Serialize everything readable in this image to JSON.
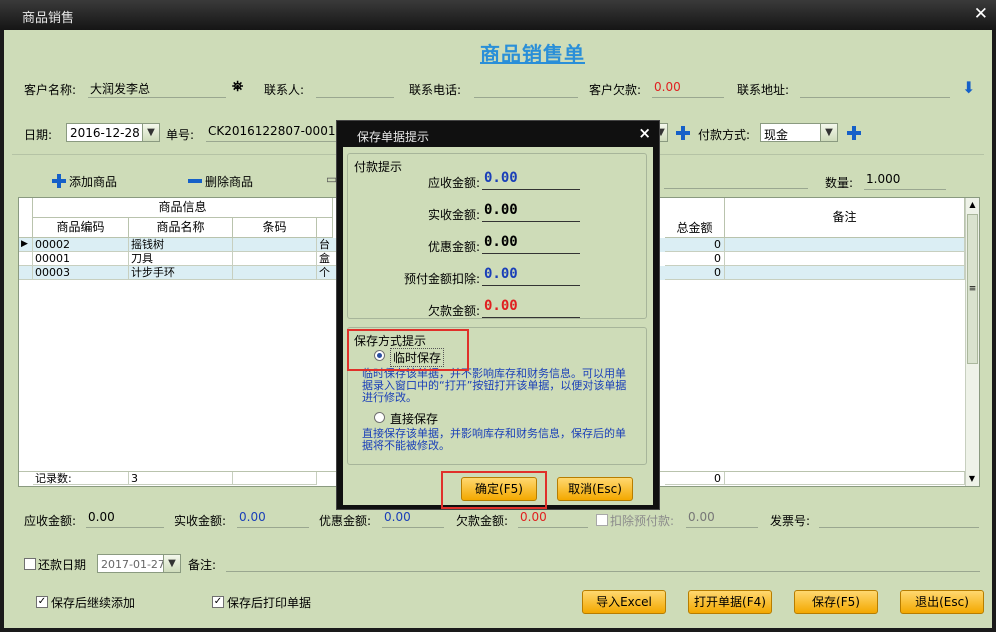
{
  "window": {
    "title": "商品销售",
    "close": "✕"
  },
  "page_title": "商品销售单",
  "customer_row": {
    "customer_label": "客户名称:",
    "customer_value": "大润发李总",
    "contact_label": "联系人:",
    "phone_label": "联系电话:",
    "debt_label": "客户欠款:",
    "debt_value": "0.00",
    "address_label": "联系地址:"
  },
  "order_row": {
    "date_label": "日期:",
    "date_value": "2016-12-28",
    "number_label": "单号:",
    "number_value": "CK2016122807-0001",
    "payment_label": "付款方式:",
    "payment_value": "现金"
  },
  "toolbar": {
    "add_goods": "添加商品",
    "delete_goods": "删除商品",
    "qty_label": "数量:",
    "qty_value": "1.000"
  },
  "grid": {
    "group_header": "商品信息",
    "columns": [
      "商品编码",
      "商品名称",
      "条码"
    ],
    "total_col": "总金额",
    "remark_col": "备注",
    "rows": [
      {
        "code": "00002",
        "name": "摇钱树",
        "barcode": "",
        "unit": "台",
        "total": "0"
      },
      {
        "code": "00001",
        "name": "刀具",
        "barcode": "",
        "unit": "盒",
        "total": "0"
      },
      {
        "code": "00003",
        "name": "计步手环",
        "barcode": "",
        "unit": "个",
        "total": "0"
      }
    ],
    "footer_label": "记录数:",
    "footer_count": "3",
    "footer_total": "0"
  },
  "summary": {
    "receivable_label": "应收金额:",
    "receivable_value": "0.00",
    "received_label": "实收金额:",
    "received_value": "0.00",
    "discount_label": "优惠金额:",
    "discount_value": "0.00",
    "arrears_label": "欠款金额:",
    "arrears_value": "0.00",
    "prepay_label": "扣除预付款:",
    "prepay_value": "0.00",
    "invoice_label": "发票号:"
  },
  "bottom": {
    "repay_label": "还款日期",
    "repay_date": "2017-01-27",
    "remark_label": "备注:",
    "continue_add": "保存后继续添加",
    "print_after": "保存后打印单据",
    "import_excel": "导入Excel",
    "open_doc": "打开单据(F4)",
    "save": "保存(F5)",
    "exit": "退出(Esc)"
  },
  "dialog": {
    "title": "保存单据提示",
    "close": "×",
    "pay_group": "付款提示",
    "receivable_label": "应收金额:",
    "receivable_value": "0.00",
    "received_label": "实收金额:",
    "received_value": "0.00",
    "discount_label": "优惠金额:",
    "discount_value": "0.00",
    "prepay_label": "预付金额扣除:",
    "prepay_value": "0.00",
    "arrears_label": "欠款金额:",
    "arrears_value": "0.00",
    "save_group": "保存方式提示",
    "temp_save": "临时保存",
    "temp_desc": "临时保存该单据，并不影响库存和财务信息。可以用单据录入窗口中的“打开”按钮打开该单据，以便对该单据进行修改。",
    "direct_save": "直接保存",
    "direct_desc": "直接保存该单据，并影响库存和财务信息，保存后的单据将不能被修改。",
    "ok": "确定(F5)",
    "cancel": "取消(Esc)"
  },
  "colors": {
    "accent_title": "#2a8fd8",
    "debt": "#e02020",
    "panel": "#cedcb8",
    "button": "#f3a800"
  }
}
